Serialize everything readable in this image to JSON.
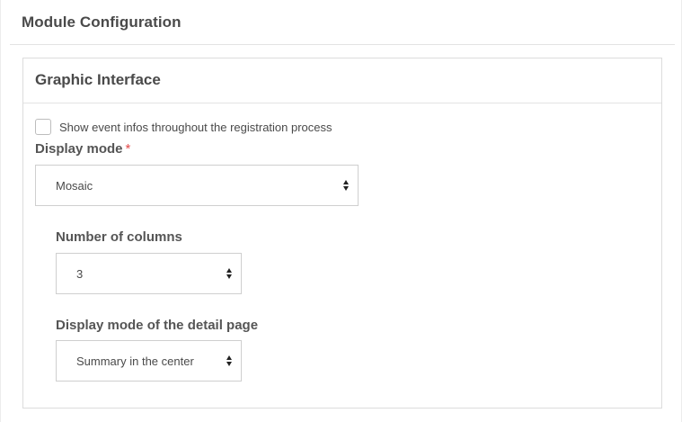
{
  "module": {
    "title": "Module Configuration"
  },
  "panel": {
    "title": "Graphic Interface",
    "show_event_infos": {
      "label": "Show event infos throughout the registration process",
      "checked": false
    },
    "display_mode": {
      "label": "Display mode",
      "required_marker": "*",
      "value": "Mosaic"
    },
    "number_of_columns": {
      "label": "Number of columns",
      "value": "3"
    },
    "detail_page_mode": {
      "label": "Display mode of the detail page",
      "value": "Summary in the center"
    }
  },
  "icons": {
    "select_arrows": "up-down-chevron-icon"
  }
}
